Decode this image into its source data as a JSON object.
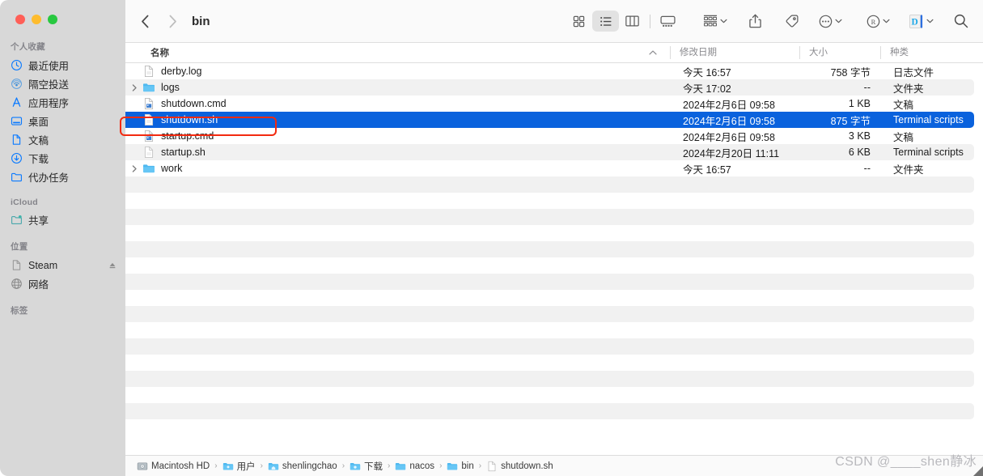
{
  "window": {
    "title": "bin",
    "traffic_lights": [
      "close-red",
      "minimize-yellow",
      "maximize-green"
    ],
    "colors": {
      "accent_selection": "#0a62dd",
      "sidebar_icon_blue": "#0a7aff",
      "annotation_red": "#f22a10",
      "traffic_red": "#ff5f57",
      "traffic_yellow": "#febc2e",
      "traffic_green": "#28c840",
      "stripe_gray": "#f1f1f1"
    }
  },
  "toolbar": {
    "back_label": "‹",
    "forward_label": "›",
    "view_modes": [
      {
        "name": "icon-view",
        "active": false
      },
      {
        "name": "list-view",
        "active": true
      },
      {
        "name": "column-view",
        "active": false
      },
      {
        "name": "gallery-view",
        "active": false
      }
    ],
    "group_by_label": "group-by",
    "share_label": "share",
    "tag_label": "tag",
    "more_label": "more-actions",
    "registered_label": "registered-app",
    "dict_app_label": "D",
    "search_label": "search"
  },
  "columns": {
    "name": "名称",
    "date_modified": "修改日期",
    "size": "大小",
    "kind": "种类",
    "sort_direction": "ascending"
  },
  "sidebar": {
    "sections": [
      {
        "title": "个人收藏",
        "items": [
          {
            "label": "最近使用",
            "icon": "clock-icon"
          },
          {
            "label": "隔空投送",
            "icon": "airdrop-icon"
          },
          {
            "label": "应用程序",
            "icon": "applications-icon"
          },
          {
            "label": "桌面",
            "icon": "desktop-icon"
          },
          {
            "label": "文稿",
            "icon": "documents-icon"
          },
          {
            "label": "下载",
            "icon": "downloads-icon"
          },
          {
            "label": "代办任务",
            "icon": "folder-icon"
          }
        ]
      },
      {
        "title": "iCloud",
        "items": [
          {
            "label": "共享",
            "icon": "shared-folder-icon"
          }
        ]
      },
      {
        "title": "位置",
        "items": [
          {
            "label": "Steam",
            "icon": "disk-image-icon",
            "eject": true
          },
          {
            "label": "网络",
            "icon": "network-globe-icon"
          }
        ]
      },
      {
        "title": "标签",
        "items": []
      }
    ]
  },
  "files": [
    {
      "name": "derby.log",
      "date": "今天 16:57",
      "size": "758 字节",
      "kind": "日志文件",
      "icon": "document-icon",
      "expandable": false,
      "selected": false
    },
    {
      "name": "logs",
      "date": "今天 17:02",
      "size": "--",
      "kind": "文件夹",
      "icon": "folder-icon",
      "expandable": true,
      "selected": false
    },
    {
      "name": "shutdown.cmd",
      "date": "2024年2月6日 09:58",
      "size": "1 KB",
      "kind": "文稿",
      "icon": "exec-document-icon",
      "expandable": false,
      "selected": false
    },
    {
      "name": "shutdown.sh",
      "date": "2024年2月6日 09:58",
      "size": "875 字节",
      "kind": "Terminal scripts",
      "icon": "document-icon",
      "expandable": false,
      "selected": true
    },
    {
      "name": "startup.cmd",
      "date": "2024年2月6日 09:58",
      "size": "3 KB",
      "kind": "文稿",
      "icon": "exec-document-icon",
      "expandable": false,
      "selected": false
    },
    {
      "name": "startup.sh",
      "date": "2024年2月20日 11:11",
      "size": "6 KB",
      "kind": "Terminal scripts",
      "icon": "document-icon",
      "expandable": false,
      "selected": false
    },
    {
      "name": "work",
      "date": "今天 16:57",
      "size": "--",
      "kind": "文件夹",
      "icon": "folder-icon",
      "expandable": true,
      "selected": false
    }
  ],
  "breadcrumb": [
    {
      "label": "Macintosh HD",
      "icon": "harddisk-icon"
    },
    {
      "label": "用户",
      "icon": "users-folder-icon"
    },
    {
      "label": "shenlingchao",
      "icon": "home-folder-icon"
    },
    {
      "label": "下载",
      "icon": "downloads-folder-icon"
    },
    {
      "label": "nacos",
      "icon": "folder-icon"
    },
    {
      "label": "bin",
      "icon": "folder-icon"
    },
    {
      "label": "shutdown.sh",
      "icon": "document-icon"
    }
  ],
  "breadcrumb_separator": "›",
  "watermark": "CSDN @____shen静冰"
}
